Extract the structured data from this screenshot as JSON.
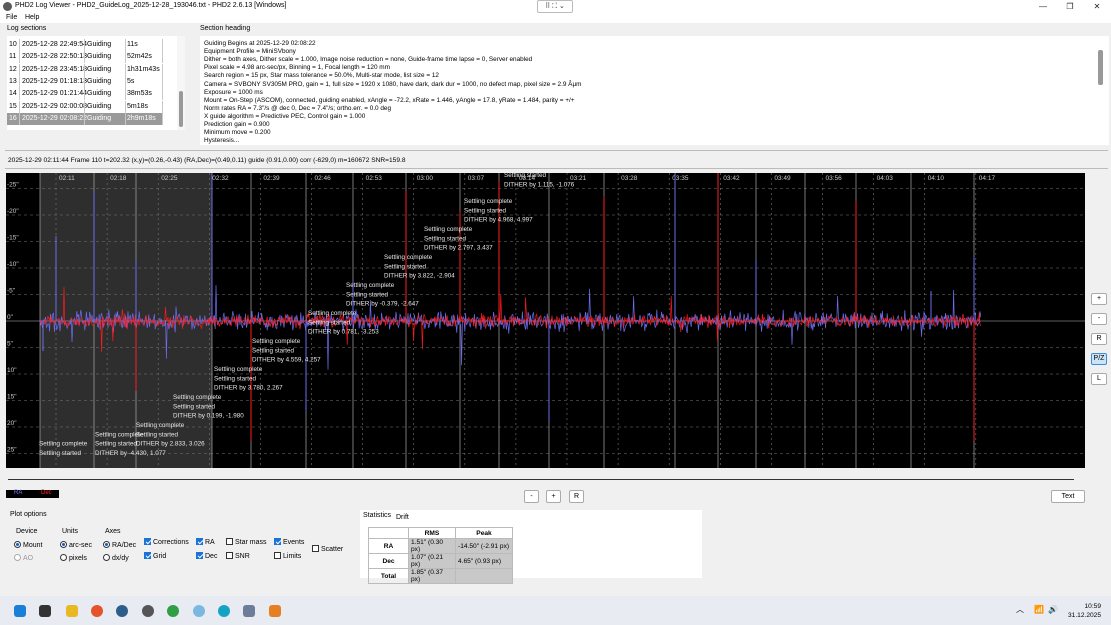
{
  "window": {
    "title": "PHD2 Log Viewer - PHD2_GuideLog_2025-12-28_193046.txt - PHD2 2.6.13 [Windows]",
    "minimize": "—",
    "maximize": "❐",
    "close": "✕"
  },
  "menu": {
    "file": "File",
    "help": "Help"
  },
  "log_sections": {
    "label": "Log sections",
    "rows": [
      {
        "num": "10",
        "date": "2025-12-28 22:49:54",
        "type": "Guiding",
        "dur": "11s"
      },
      {
        "num": "11",
        "date": "2025-12-28 22:50:13",
        "type": "Guiding",
        "dur": "52m42s"
      },
      {
        "num": "12",
        "date": "2025-12-28 23:45:18",
        "type": "Guiding",
        "dur": "1h31m43s"
      },
      {
        "num": "13",
        "date": "2025-12-29 01:18:13",
        "type": "Guiding",
        "dur": "5s"
      },
      {
        "num": "14",
        "date": "2025-12-29 01:21:44",
        "type": "Guiding",
        "dur": "38m53s"
      },
      {
        "num": "15",
        "date": "2025-12-29 02:00:08",
        "type": "Guiding",
        "dur": "5m18s"
      },
      {
        "num": "16",
        "date": "2025-12-29 02:08:22",
        "type": "Guiding",
        "dur": "2h9m18s"
      }
    ],
    "selected_index": 6
  },
  "section_heading": {
    "label": "Section heading",
    "lines": [
      "Guiding Begins at 2025-12-29 02:08:22",
      "Equipment Profile = MiniSVbony",
      "Dither = both axes, Dither scale = 1.000, Image noise reduction = none, Guide-frame time lapse = 0, Server enabled",
      "Pixel scale = 4.98 arc-sec/px, Binning = 1, Focal length = 120 mm",
      "Search region = 15 px, Star mass tolerance = 50.0%, Multi-star mode, list size = 12",
      " Camera = SVBONY SV305M PRO, gain = 1, full size = 1920 x 1080, have dark, dark dur = 1000, no defect map, pixel size = 2.9 Âµm",
      "Exposure = 1000 ms",
      "Mount = On-Step (ASCOM), connected, guiding enabled, xAngle = -72.2, xRate = 1.446, yAngle = 17.8, yRate = 1.484, parity = +/+",
      "Norm rates RA = 7.3\"/s @ dec 0, Dec = 7.4\"/s; ortho.err. = 0.0 deg",
      "X guide algorithm = Predictive PEC, Control gain = 1.000",
      "Prediction gain = 0.900",
      "Minimum move = 0.200",
      "Hysteresis..."
    ]
  },
  "frame_info": "2025-12-29 02:11:44 Frame 110 t=202.32 (x,y)=(0.26,-0.43) (RA,Dec)=(0.49,0.11) guide (0.91,0.00) corr (-629,0) m=160672 SNR=159.8",
  "graph": {
    "time_labels": [
      "02:11",
      "02:18",
      "02:25",
      "02:32",
      "02:39",
      "02:46",
      "02:53",
      "03:00",
      "03:07",
      "03:14",
      "03:21",
      "03:28",
      "03:35",
      "03:42",
      "03:49",
      "03:56",
      "04:03",
      "04:10",
      "04:17"
    ],
    "y_labels": [
      "25\"",
      "20\"",
      "15\"",
      "10\"",
      "5\"",
      "0\"",
      "-5\"",
      "-10\"",
      "-15\"",
      "-20\"",
      "-25\""
    ],
    "annotations": [
      {
        "lines": [
          "Settling complete",
          "Settling started"
        ]
      },
      {
        "lines": [
          "Settling complete",
          "Settling started",
          "DITHER by -4.430, 1.077"
        ]
      },
      {
        "lines": [
          "Settling complete",
          "Settling started",
          "DITHER by 2.833, 3.026"
        ]
      },
      {
        "lines": [
          "Settling complete",
          "Settling started",
          "DITHER by 0.199, -1.980"
        ]
      },
      {
        "lines": [
          "Settling complete",
          "Settling started",
          "DITHER by 3.780, 2.267"
        ]
      },
      {
        "lines": [
          "Settling complete",
          "Settling started",
          "DITHER by 4.559, 4.257"
        ]
      },
      {
        "lines": [
          "Settling complete",
          "Settling started",
          "DITHER by 0.781, -3.253"
        ]
      },
      {
        "lines": [
          "Settling complete",
          "Settling started",
          "DITHER by -0.379, -2.647"
        ]
      },
      {
        "lines": [
          "Settling complete",
          "Settling started",
          "DITHER by 3.822, -2.904"
        ]
      },
      {
        "lines": [
          "Settling complete",
          "Settling started",
          "DITHER by 2.797, 3.437"
        ]
      },
      {
        "lines": [
          "Settling complete",
          "Settling started",
          "DITHER by 4.968, 4.997"
        ]
      },
      {
        "lines": [
          "Settling started",
          "DITHER by 1.115, -1.076"
        ]
      }
    ],
    "colors": {
      "ra": "#6e6ef0",
      "dec": "#ff1e1e",
      "bg": "#000000",
      "grid": "#777777"
    }
  },
  "side_buttons": {
    "plus": "+",
    "minus": "-",
    "r": "R",
    "pz": "P/Z",
    "l": "L"
  },
  "legend": {
    "ra": "RA",
    "dec": "Dec"
  },
  "bottom_buttons": {
    "minus": "-",
    "plus": "+",
    "r": "R",
    "text": "Text"
  },
  "plot_options": {
    "title": "Plot options",
    "device": {
      "label": "Device",
      "mount": "Mount",
      "ao": "AO"
    },
    "units": {
      "label": "Units",
      "arcsec": "arc-sec",
      "pixels": "pixels"
    },
    "axes": {
      "label": "Axes",
      "radec": "RA/Dec",
      "dxdy": "dx/dy"
    },
    "checks": {
      "corrections": "Corrections",
      "grid": "Grid",
      "ra": "RA",
      "dec": "Dec",
      "star_mass": "Star mass",
      "snr": "SNR",
      "events": "Events",
      "limits": "Limits",
      "scatter": "Scatter"
    }
  },
  "stats": {
    "tab_statistics": "Statistics",
    "tab_drift": "Drift",
    "headers": [
      "",
      "RMS",
      "Peak"
    ],
    "rows": [
      {
        "name": "RA",
        "rms": "1.51\" (0.30 px)",
        "peak": "-14.50\" (-2.91 px)"
      },
      {
        "name": "Dec",
        "rms": "1.07\" (0.21 px)",
        "peak": "4.65\" (0.93 px)"
      },
      {
        "name": "Total",
        "rms": "1.85\" (0.37 px)",
        "peak": ""
      }
    ]
  },
  "taskbar": {
    "time": "10:59",
    "date": "31.12.2025",
    "chevron": "︿"
  }
}
